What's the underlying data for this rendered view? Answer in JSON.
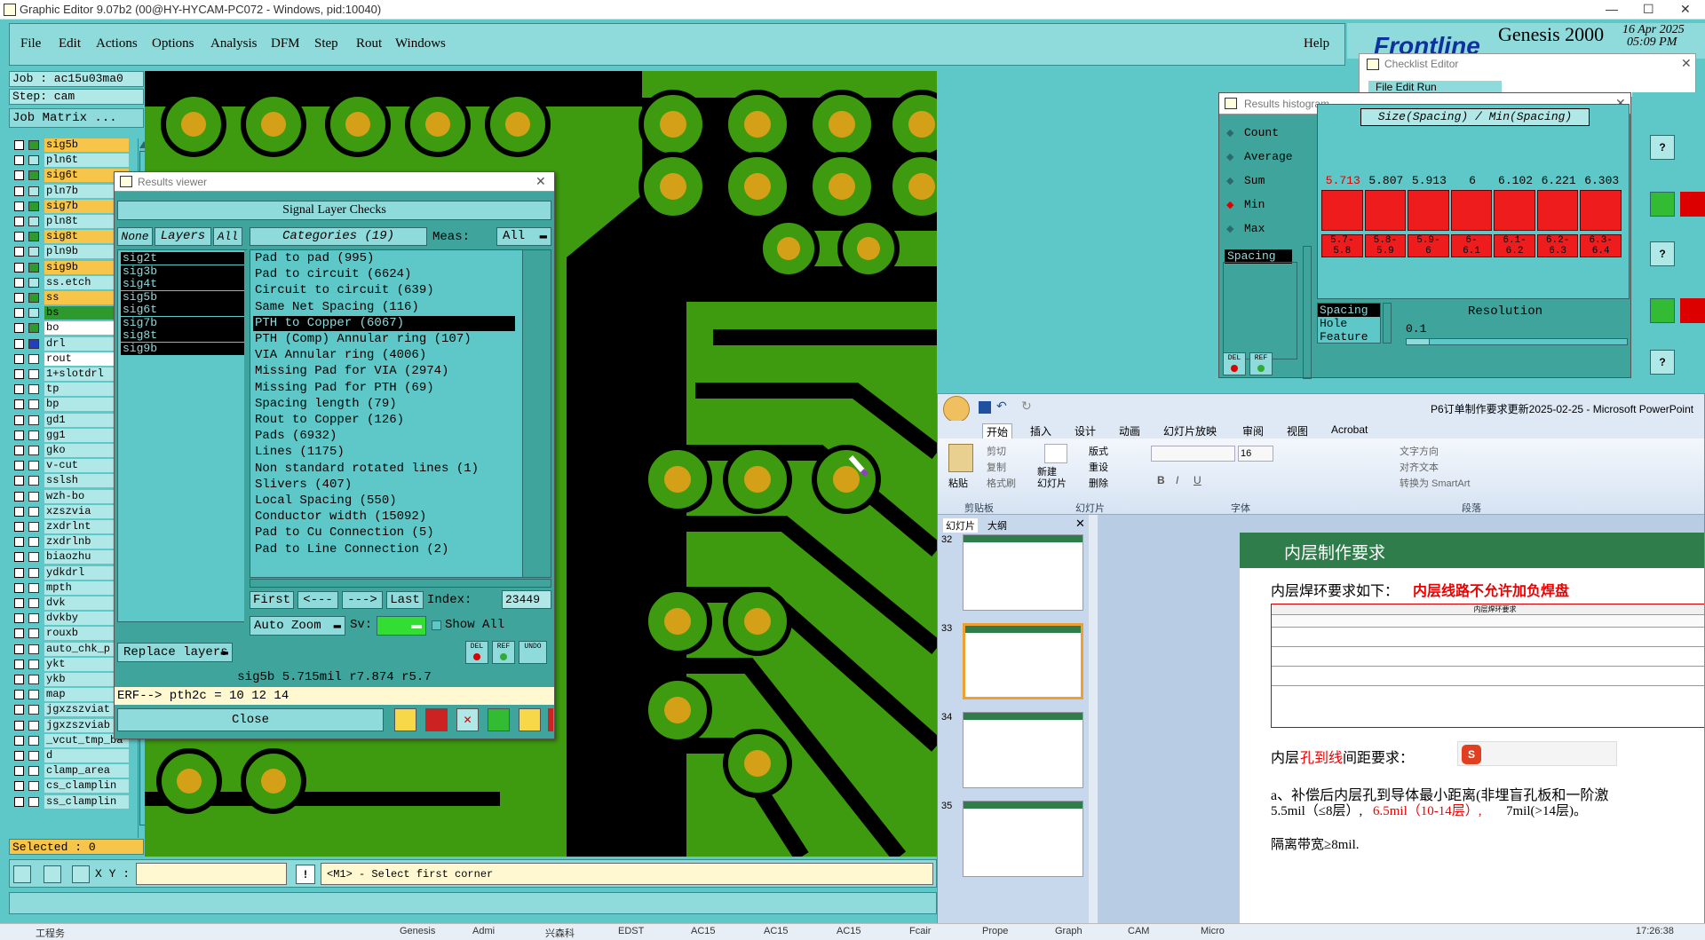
{
  "window": {
    "title": "Graphic Editor 9.07b2 (00@HY-HYCAM-PC072 - Windows, pid:10040)"
  },
  "menu": {
    "items": [
      "File",
      "Edit",
      "Actions",
      "Options",
      "Analysis",
      "DFM",
      "Step",
      "Rout",
      "Windows"
    ],
    "help": "Help"
  },
  "brand": {
    "logo": "Frontline",
    "product": "Genesis 2000",
    "date": "16 Apr 2025",
    "time": "05:09 PM"
  },
  "job": {
    "job": "Job : ac15u03ma0",
    "step": "Step: cam",
    "matrix": "Job Matrix ..."
  },
  "layers": [
    {
      "name": "sig5b",
      "bg": "#f7c54a"
    },
    {
      "name": "pln6t",
      "bg": "#b0e8e8"
    },
    {
      "name": "sig6t",
      "bg": "#f7c54a"
    },
    {
      "name": "pln7b",
      "bg": "#b0e8e8"
    },
    {
      "name": "sig7b",
      "bg": "#f7c54a"
    },
    {
      "name": "pln8t",
      "bg": "#b0e8e8"
    },
    {
      "name": "sig8t",
      "bg": "#f7c54a"
    },
    {
      "name": "pln9b",
      "bg": "#b0e8e8"
    },
    {
      "name": "sig9b",
      "bg": "#f7c54a"
    },
    {
      "name": "ss.etch",
      "bg": "#b0e8e8"
    },
    {
      "name": "ss",
      "bg": "#f7c54a"
    },
    {
      "name": "bs",
      "bg": "#2e9a2e"
    },
    {
      "name": "bo",
      "bg": "#ffffff"
    },
    {
      "name": "drl",
      "bg": "#b0e8e8"
    },
    {
      "name": "rout",
      "bg": "#ffffff"
    },
    {
      "name": "1+slotdrl",
      "bg": "#b0e8e8"
    },
    {
      "name": "tp",
      "bg": "#b0e8e8"
    },
    {
      "name": "bp",
      "bg": "#b0e8e8"
    },
    {
      "name": "gd1",
      "bg": "#b0e8e8"
    },
    {
      "name": "gg1",
      "bg": "#b0e8e8"
    },
    {
      "name": "gko",
      "bg": "#b0e8e8"
    },
    {
      "name": "v-cut",
      "bg": "#b0e8e8"
    },
    {
      "name": "sslsh",
      "bg": "#b0e8e8"
    },
    {
      "name": "wzh-bo",
      "bg": "#b0e8e8"
    },
    {
      "name": "xzszvia",
      "bg": "#b0e8e8"
    },
    {
      "name": "zxdrlnt",
      "bg": "#b0e8e8"
    },
    {
      "name": "zxdrlnb",
      "bg": "#b0e8e8"
    },
    {
      "name": "biaozhu",
      "bg": "#b0e8e8"
    },
    {
      "name": "ydkdrl",
      "bg": "#b0e8e8"
    },
    {
      "name": "mpth",
      "bg": "#b0e8e8"
    },
    {
      "name": "dvk",
      "bg": "#b0e8e8"
    },
    {
      "name": "dvkby",
      "bg": "#b0e8e8"
    },
    {
      "name": "rouxb",
      "bg": "#b0e8e8"
    },
    {
      "name": "auto_chk_p",
      "bg": "#b0e8e8"
    },
    {
      "name": "ykt",
      "bg": "#b0e8e8"
    },
    {
      "name": "ykb",
      "bg": "#b0e8e8"
    },
    {
      "name": "map",
      "bg": "#b0e8e8"
    },
    {
      "name": "jgxzszviat",
      "bg": "#b0e8e8"
    },
    {
      "name": "jgxzszviab",
      "bg": "#b0e8e8"
    },
    {
      "name": "_vcut_tmp_ba",
      "bg": "#b0e8e8"
    },
    {
      "name": "d",
      "bg": "#b0e8e8"
    },
    {
      "name": "clamp_area",
      "bg": "#b0e8e8"
    },
    {
      "name": "cs_clamplin",
      "bg": "#b0e8e8"
    },
    {
      "name": "ss_clamplin",
      "bg": "#b0e8e8"
    }
  ],
  "selected": "Selected : 0",
  "statusbar": {
    "xy": "X Y :",
    "prompt": "<M1> - Select first corner"
  },
  "results_viewer": {
    "title": "Results viewer",
    "header": "Signal Layer Checks",
    "none": "None",
    "layers": "Layers",
    "all": "All",
    "categories_label": "Categories (19)",
    "meas_label": "Meas:",
    "meas_value": "All",
    "layer_items": [
      "sig2t",
      "sig3b",
      "sig4t",
      "sig5b",
      "sig6t",
      "sig7b",
      "sig8t",
      "sig9b"
    ],
    "categories": [
      "Pad to pad (995)",
      "Pad to circuit (6624)",
      "Circuit to circuit (639)",
      "Same Net Spacing (116)",
      "PTH to Copper (6067)",
      "PTH (Comp) Annular ring (107)",
      "VIA Annular ring (4006)",
      "Missing Pad for VIA (2974)",
      "Missing Pad for PTH (69)",
      "Spacing length (79)",
      "Rout to Copper (126)",
      "Pads (6932)",
      "Lines (1175)",
      "Non standard rotated lines (1)",
      "Slivers (407)",
      "Local Spacing (550)",
      "Conductor width (15092)",
      "Pad to Cu Connection (5)",
      "Pad to Line Connection (2)"
    ],
    "selected_category": "PTH to Copper (6067)",
    "nav": {
      "first": "First",
      "prev": "<---",
      "next": "--->",
      "last": "Last",
      "index_label": "Index:",
      "index_value": "23449"
    },
    "auto_zoom": "Auto Zoom",
    "sv": "Sv:",
    "show_all": "Show All",
    "replace_layers": "Replace layers",
    "del": "DEL",
    "ref": "REF",
    "undo": "UNDO",
    "info": "sig5b  5.715mil  r7.874  r5.7",
    "erf": "ERF--> pth2c = 10 12 14",
    "close": "Close"
  },
  "checklist_editor": {
    "title": "Checklist Editor",
    "menu": "File  Edit  Run"
  },
  "results_histogram": {
    "title": "Results histogram",
    "options": [
      "Count",
      "Average",
      "Sum",
      "Min",
      "Max"
    ],
    "selected_option": "Min",
    "field": "Spacing",
    "header": "Size(Spacing) / Min(Spacing)",
    "values": [
      "5.713",
      "5.807",
      "5.913",
      "6",
      "6.102",
      "6.221",
      "6.303"
    ],
    "ranges_top": [
      "5.7-",
      "5.8-",
      "5.9-",
      "6-",
      "6.1-",
      "6.2-",
      "6.3-"
    ],
    "ranges_bottom": [
      "5.8",
      "5.9",
      "6",
      "6.1",
      "6.2",
      "6.3",
      "6.4"
    ],
    "group_items": [
      "Spacing",
      "Hole",
      "Feature"
    ],
    "resolution_label": "Resolution",
    "resolution_value": "0.1",
    "del": "DEL",
    "ref": "REF"
  },
  "ppt": {
    "title": "P6订单制作要求更新2025-02-25 - Microsoft PowerPoint",
    "tabs": [
      "开始",
      "插入",
      "设计",
      "动画",
      "幻灯片放映",
      "审阅",
      "视图",
      "Acrobat"
    ],
    "clip": {
      "paste": "粘贴",
      "cut": "剪切",
      "copy": "复制",
      "format": "格式刷",
      "group": "剪贴板"
    },
    "slides": {
      "new": "新建\n幻灯片",
      "layout": "版式",
      "reset": "重设",
      "delete": "删除",
      "group": "幻灯片"
    },
    "font": {
      "size": "16",
      "group": "字体"
    },
    "para": {
      "dir": "文字方向",
      "align": "对齐文本",
      "smart": "转换为 SmartArt",
      "group": "段落"
    },
    "pane_tabs": [
      "幻灯片",
      "大纲"
    ],
    "thumbs": [
      "32",
      "33",
      "34",
      "35"
    ],
    "slide_title": "内层制作要求",
    "line1_a": "内层焊环要求如下：",
    "line1_b": "内层线路不允许加负焊盘",
    "table_title": "内层焊环要求",
    "line2_a": "内层",
    "line2_b": "孔到线",
    "line2_c": "间距要求：",
    "line3": "a、补偿后内层孔到导体最小距离(非埋盲孔板和一阶激",
    "line4_a": "5.5mil（≤8层）,",
    "line4_b": "6.5mil（10-14层）,",
    "line4_c": "7mil(>14层)。",
    "line5": "隔离带宽≥8mil."
  },
  "taskbar": {
    "items": [
      "工程务",
      "",
      "",
      "",
      "",
      "Genesis",
      "Admi",
      "兴森科",
      "EDST",
      "AC15",
      "AC15",
      "AC15",
      "Fcair",
      "Prope",
      "Graph",
      "CAM",
      "Micro"
    ],
    "time": "17:26:38"
  }
}
